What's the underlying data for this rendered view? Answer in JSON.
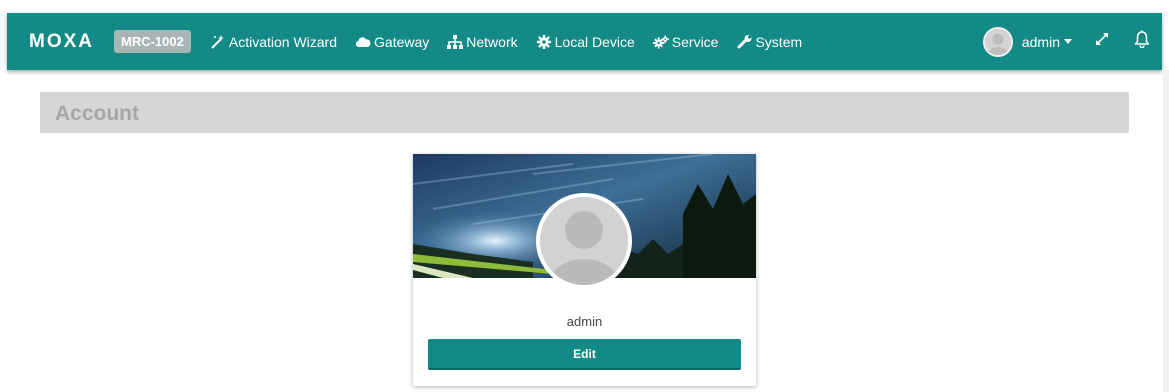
{
  "header": {
    "logo": "MOXA",
    "model": "MRC-1002",
    "nav": [
      {
        "label": "Activation Wizard",
        "icon": "magic-wand-icon"
      },
      {
        "label": "Gateway",
        "icon": "cloud-icon"
      },
      {
        "label": "Network",
        "icon": "sitemap-icon"
      },
      {
        "label": "Local Device",
        "icon": "cog-icon"
      },
      {
        "label": "Service",
        "icon": "cogs-icon"
      },
      {
        "label": "System",
        "icon": "wrench-icon"
      }
    ],
    "user": "admin"
  },
  "section": {
    "title": "Account"
  },
  "card": {
    "name": "admin",
    "edit_label": "Edit"
  },
  "colors": {
    "primary": "#148a86",
    "badge": "#a9b5b4",
    "section_bg": "#d6d6d6",
    "section_text": "#a6a6a6"
  }
}
